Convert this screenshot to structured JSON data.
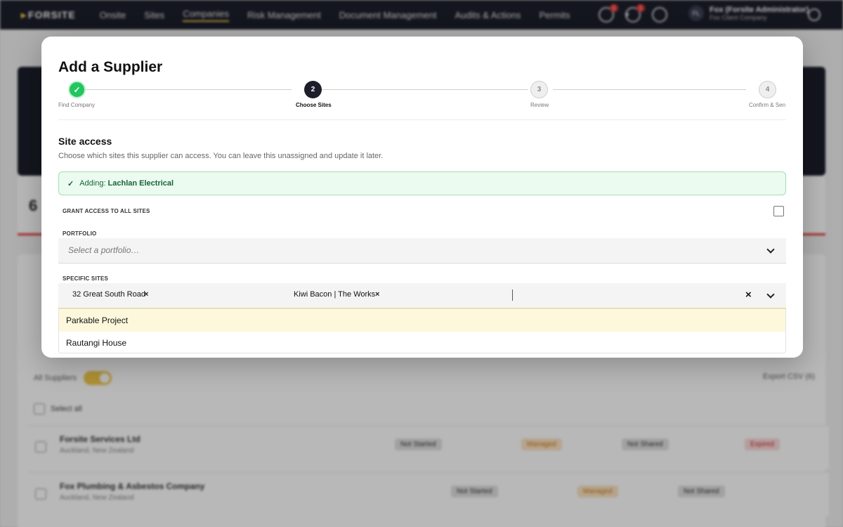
{
  "nav": {
    "logo": "FORSITE",
    "items": [
      {
        "label": "Onsite"
      },
      {
        "label": "Sites"
      },
      {
        "label": "Companies"
      },
      {
        "label": "Risk Management"
      },
      {
        "label": "Document Management"
      },
      {
        "label": "Audits & Actions"
      },
      {
        "label": "Permits"
      }
    ],
    "active_item": "Companies",
    "notification_badges": [
      "1",
      "1"
    ],
    "user": {
      "initials": "FL",
      "name": "Fox (Forsite Administrator)",
      "company": "Fox Client Company"
    }
  },
  "background": {
    "stat_value": "6",
    "toggle_label": "All Suppliers",
    "export_label": "Export CSV (6)",
    "select_all_label": "Select all",
    "rows": [
      {
        "name": "Forsite Services Ltd",
        "location": "Auckland, New Zealand",
        "pill_1": "Not Started",
        "pill_2": "Managed",
        "pill_3": "Not Shared",
        "pill_4": "Expired"
      },
      {
        "name": "Fox Plumbing & Asbestos Company",
        "location": "Auckland, New Zealand",
        "pill_1": "Not Started",
        "pill_2": "Managed",
        "pill_3": "Not Shared",
        "pill_4": ""
      }
    ]
  },
  "modal": {
    "title": "Add a Supplier",
    "steps": [
      {
        "number": "✓",
        "label": "Find Company",
        "state": "done"
      },
      {
        "number": "2",
        "label": "Choose Sites",
        "state": "current"
      },
      {
        "number": "3",
        "label": "Review",
        "state": "future"
      },
      {
        "number": "4",
        "label": "Confirm & Sen",
        "state": "future"
      }
    ],
    "section_title": "Site access",
    "section_description": "Choose which sites this supplier can access. You can leave this unassigned and update it later.",
    "alert": {
      "check": "✓",
      "prefix": "Adding:",
      "company": "Lachlan Electrical"
    },
    "grant_all_label": "GRANT ACCESS TO ALL SITES",
    "grant_all_checked": false,
    "portfolio": {
      "label": "PORTFOLIO",
      "placeholder": "Select a portfolio…"
    },
    "specific_sites": {
      "label": "SPECIFIC SITES",
      "selected": [
        "32 Great South Road",
        "Kiwi Bacon | The Works"
      ],
      "chip_remove": "×",
      "clear_all": "×",
      "options": [
        "Parkable Project",
        "Rautangi House"
      ],
      "highlighted_option": "Parkable Project"
    }
  }
}
